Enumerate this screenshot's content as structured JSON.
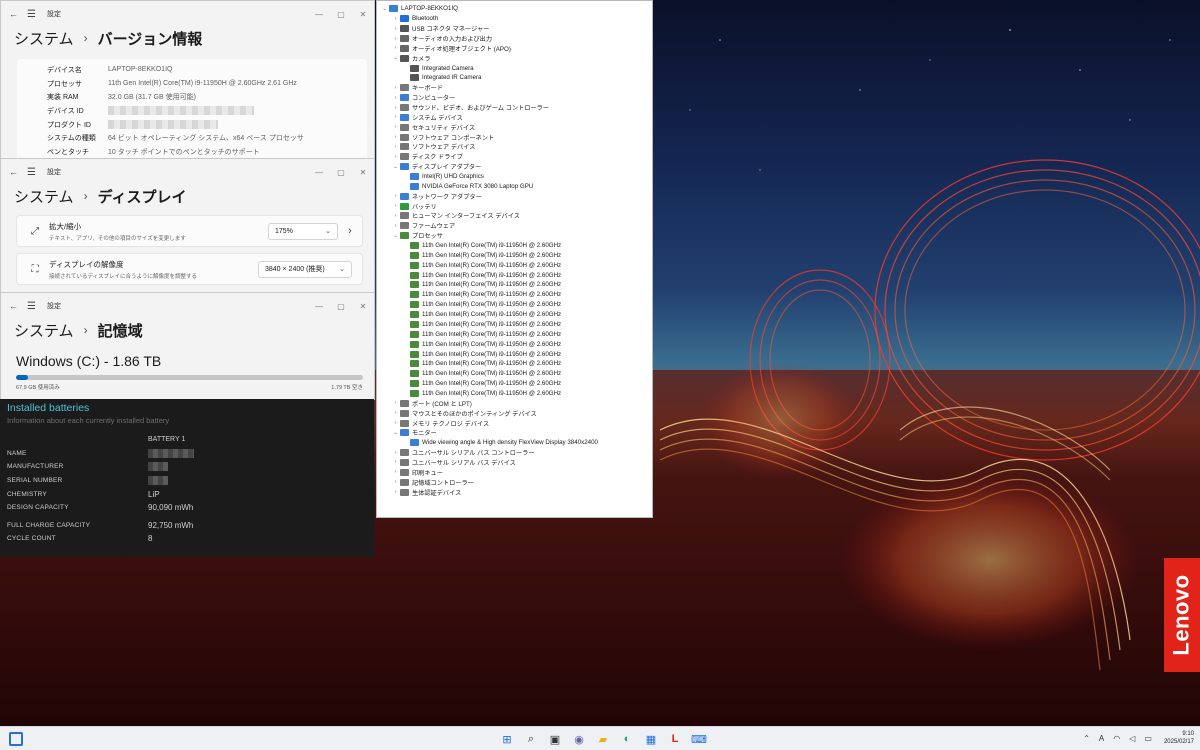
{
  "brand": {
    "logo_text": "Lenovo",
    "logo_color": "#e2231a",
    "accent": "#0067c0"
  },
  "version_window": {
    "app_name": "設定",
    "breadcrumb_parent": "システム",
    "breadcrumb_current": "バージョン情報",
    "specs": [
      {
        "label": "デバイス名",
        "value": "LAPTOP-8EKKO1IQ"
      },
      {
        "label": "プロセッサ",
        "value": "11th Gen Intel(R) Core(TM) i9-11950H @ 2.60GHz   2.61 GHz"
      },
      {
        "label": "実装 RAM",
        "value": "32.0 GB (31.7 GB 使用可能)"
      },
      {
        "label": "デバイス ID",
        "value": ""
      },
      {
        "label": "プロダクト ID",
        "value": ""
      },
      {
        "label": "システムの種類",
        "value": "64 ビット オペレーティング システム、x64 ベース プロセッサ"
      },
      {
        "label": "ペンとタッチ",
        "value": "10 タッチ ポイントでのペンとタッチのサポート"
      }
    ]
  },
  "display_window": {
    "app_name": "設定",
    "breadcrumb_parent": "システム",
    "breadcrumb_current": "ディスプレイ",
    "scale": {
      "title": "拡大/縮小",
      "subtitle": "テキスト、アプリ、その他の項目のサイズを変更します",
      "value": "175%"
    },
    "resolution": {
      "title": "ディスプレイの解像度",
      "subtitle": "接続されているディスプレイに合うように解像度を調整する",
      "value": "3840 × 2400 (推奨)"
    }
  },
  "storage_window": {
    "app_name": "設定",
    "breadcrumb_parent": "システム",
    "breadcrumb_current": "記憶域",
    "drive_title": "Windows (C:) - 1.86 TB",
    "used_label": "67.9 GB 使用済み",
    "free_label": "1.79 TB 空き",
    "used_fraction": 0.036
  },
  "battery_report": {
    "title": "Installed batteries",
    "subtitle": "Information about each currently installed battery",
    "column_header": "BATTERY 1",
    "rows": [
      {
        "label": "NAME",
        "value": ""
      },
      {
        "label": "MANUFACTURER",
        "value": ""
      },
      {
        "label": "SERIAL NUMBER",
        "value": ""
      },
      {
        "label": "CHEMISTRY",
        "value": "LiP"
      },
      {
        "label": "DESIGN CAPACITY",
        "value": "90,090 mWh"
      },
      {
        "label": "FULL CHARGE CAPACITY",
        "value": "92,750 mWh"
      },
      {
        "label": "CYCLE COUNT",
        "value": "8"
      }
    ]
  },
  "device_manager": {
    "root": "LAPTOP-8EKKO1IQ",
    "nodes": [
      {
        "label": "Bluetooth",
        "level": 1,
        "expanded": false,
        "icon_color": "#1e6fd9"
      },
      {
        "label": "USB コネクタ マネージャー",
        "level": 1,
        "expanded": false,
        "icon_color": "#555555"
      },
      {
        "label": "オーディオの入力および出力",
        "level": 1,
        "expanded": false,
        "icon_color": "#666666"
      },
      {
        "label": "オーディオ処理オブジェクト (APO)",
        "level": 1,
        "expanded": false,
        "icon_color": "#666666"
      },
      {
        "label": "カメラ",
        "level": 1,
        "expanded": true,
        "icon_color": "#555555"
      },
      {
        "label": "Integrated Camera",
        "level": 2,
        "expanded": null,
        "icon_color": "#555555"
      },
      {
        "label": "Integrated IR Camera",
        "level": 2,
        "expanded": null,
        "icon_color": "#555555"
      },
      {
        "label": "キーボード",
        "level": 1,
        "expanded": false,
        "icon_color": "#777777"
      },
      {
        "label": "コンピューター",
        "level": 1,
        "expanded": false,
        "icon_color": "#3b7fd4"
      },
      {
        "label": "サウンド、ビデオ、およびゲーム コントローラー",
        "level": 1,
        "expanded": false,
        "icon_color": "#777777"
      },
      {
        "label": "システム デバイス",
        "level": 1,
        "expanded": false,
        "icon_color": "#3b7fd4"
      },
      {
        "label": "セキュリティ デバイス",
        "level": 1,
        "expanded": false,
        "icon_color": "#777777"
      },
      {
        "label": "ソフトウェア コンポーネント",
        "level": 1,
        "expanded": false,
        "icon_color": "#777777"
      },
      {
        "label": "ソフトウェア デバイス",
        "level": 1,
        "expanded": false,
        "icon_color": "#777777"
      },
      {
        "label": "ディスク ドライブ",
        "level": 1,
        "expanded": false,
        "icon_color": "#777777"
      },
      {
        "label": "ディスプレイ アダプター",
        "level": 1,
        "expanded": true,
        "icon_color": "#3b7fd4"
      },
      {
        "label": "Intel(R) UHD Graphics",
        "level": 2,
        "expanded": null,
        "icon_color": "#3b7fd4"
      },
      {
        "label": "NVIDIA GeForce RTX 3080 Laptop GPU",
        "level": 2,
        "expanded": null,
        "icon_color": "#3b7fd4"
      },
      {
        "label": "ネットワーク アダプター",
        "level": 1,
        "expanded": false,
        "icon_color": "#3b7fd4"
      },
      {
        "label": "バッテリ",
        "level": 1,
        "expanded": false,
        "icon_color": "#2f9a3c"
      },
      {
        "label": "ヒューマン インターフェイス デバイス",
        "level": 1,
        "expanded": false,
        "icon_color": "#777777"
      },
      {
        "label": "ファームウェア",
        "level": 1,
        "expanded": false,
        "icon_color": "#777777"
      },
      {
        "label": "プロセッサ",
        "level": 1,
        "expanded": true,
        "icon_color": "#4a8a3a"
      },
      {
        "label": "11th Gen Intel(R) Core(TM) i9-11950H @ 2.60GHz",
        "level": 2,
        "expanded": null,
        "icon_color": "#4a8a3a"
      },
      {
        "label": "11th Gen Intel(R) Core(TM) i9-11950H @ 2.60GHz",
        "level": 2,
        "expanded": null,
        "icon_color": "#4a8a3a"
      },
      {
        "label": "11th Gen Intel(R) Core(TM) i9-11950H @ 2.60GHz",
        "level": 2,
        "expanded": null,
        "icon_color": "#4a8a3a"
      },
      {
        "label": "11th Gen Intel(R) Core(TM) i9-11950H @ 2.60GHz",
        "level": 2,
        "expanded": null,
        "icon_color": "#4a8a3a"
      },
      {
        "label": "11th Gen Intel(R) Core(TM) i9-11950H @ 2.60GHz",
        "level": 2,
        "expanded": null,
        "icon_color": "#4a8a3a"
      },
      {
        "label": "11th Gen Intel(R) Core(TM) i9-11950H @ 2.60GHz",
        "level": 2,
        "expanded": null,
        "icon_color": "#4a8a3a"
      },
      {
        "label": "11th Gen Intel(R) Core(TM) i9-11950H @ 2.60GHz",
        "level": 2,
        "expanded": null,
        "icon_color": "#4a8a3a"
      },
      {
        "label": "11th Gen Intel(R) Core(TM) i9-11950H @ 2.60GHz",
        "level": 2,
        "expanded": null,
        "icon_color": "#4a8a3a"
      },
      {
        "label": "11th Gen Intel(R) Core(TM) i9-11950H @ 2.60GHz",
        "level": 2,
        "expanded": null,
        "icon_color": "#4a8a3a"
      },
      {
        "label": "11th Gen Intel(R) Core(TM) i9-11950H @ 2.60GHz",
        "level": 2,
        "expanded": null,
        "icon_color": "#4a8a3a"
      },
      {
        "label": "11th Gen Intel(R) Core(TM) i9-11950H @ 2.60GHz",
        "level": 2,
        "expanded": null,
        "icon_color": "#4a8a3a"
      },
      {
        "label": "11th Gen Intel(R) Core(TM) i9-11950H @ 2.60GHz",
        "level": 2,
        "expanded": null,
        "icon_color": "#4a8a3a"
      },
      {
        "label": "11th Gen Intel(R) Core(TM) i9-11950H @ 2.60GHz",
        "level": 2,
        "expanded": null,
        "icon_color": "#4a8a3a"
      },
      {
        "label": "11th Gen Intel(R) Core(TM) i9-11950H @ 2.60GHz",
        "level": 2,
        "expanded": null,
        "icon_color": "#4a8a3a"
      },
      {
        "label": "11th Gen Intel(R) Core(TM) i9-11950H @ 2.60GHz",
        "level": 2,
        "expanded": null,
        "icon_color": "#4a8a3a"
      },
      {
        "label": "11th Gen Intel(R) Core(TM) i9-11950H @ 2.60GHz",
        "level": 2,
        "expanded": null,
        "icon_color": "#4a8a3a"
      },
      {
        "label": "ポート (COM と LPT)",
        "level": 1,
        "expanded": false,
        "icon_color": "#777777"
      },
      {
        "label": "マウスとそのほかのポインティング デバイス",
        "level": 1,
        "expanded": false,
        "icon_color": "#777777"
      },
      {
        "label": "メモリ テクノロジ デバイス",
        "level": 1,
        "expanded": false,
        "icon_color": "#777777"
      },
      {
        "label": "モニター",
        "level": 1,
        "expanded": true,
        "icon_color": "#3b7fd4"
      },
      {
        "label": "Wide viewing angle & High density FlexView Display 3840x2400",
        "level": 2,
        "expanded": null,
        "icon_color": "#3b7fd4"
      },
      {
        "label": "ユニバーサル シリアル バス コントローラー",
        "level": 1,
        "expanded": false,
        "icon_color": "#777777"
      },
      {
        "label": "ユニバーサル シリアル バス デバイス",
        "level": 1,
        "expanded": false,
        "icon_color": "#777777"
      },
      {
        "label": "印刷キュー",
        "level": 1,
        "expanded": false,
        "icon_color": "#777777"
      },
      {
        "label": "記憶域コントローラー",
        "level": 1,
        "expanded": false,
        "icon_color": "#777777"
      },
      {
        "label": "生体認証デバイス",
        "level": 1,
        "expanded": false,
        "icon_color": "#777777"
      }
    ]
  },
  "taskbar": {
    "start_icon": "windows-start-icon",
    "apps": [
      "start-icon",
      "search-icon",
      "task-view-icon",
      "chat-icon",
      "file-explorer-icon",
      "edge-icon",
      "store-icon",
      "lenovo-vantage-icon",
      "device-manager-icon"
    ],
    "tray_icons": [
      "chevron-up-icon",
      "ime-icon",
      "wifi-icon",
      "volume-icon",
      "battery-icon"
    ],
    "ime_label": "A",
    "time": "9:10",
    "date": "2025/02/17"
  }
}
